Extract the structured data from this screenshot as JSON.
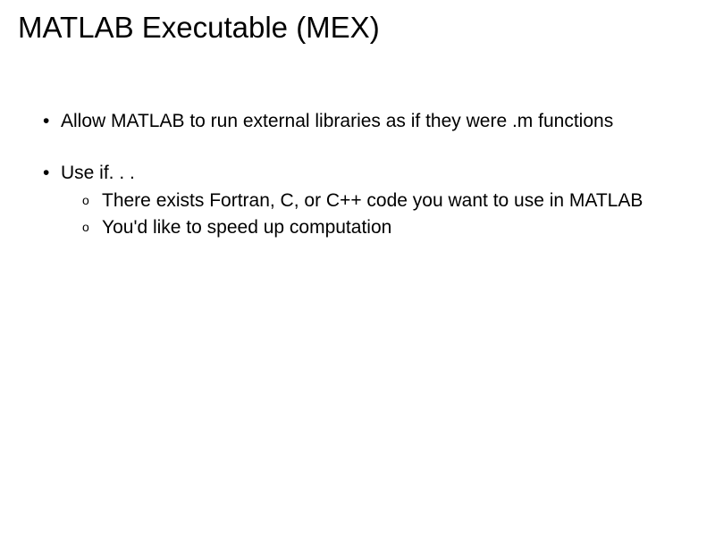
{
  "title": "MATLAB Executable (MEX)",
  "bullets": [
    {
      "text": "Allow MATLAB to run external libraries as if they were .m functions"
    },
    {
      "text": "Use if. . .",
      "sub": [
        "There exists Fortran, C, or C++ code you want to use in MATLAB",
        "You'd like to speed up computation"
      ]
    }
  ]
}
